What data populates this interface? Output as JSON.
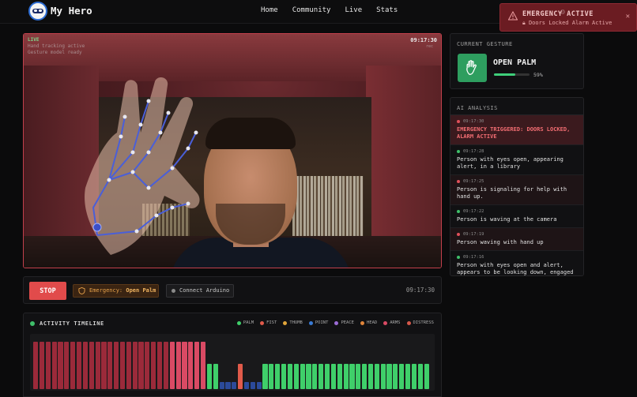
{
  "header": {
    "brand": "My Hero",
    "nav": [
      "Home",
      "Community",
      "Live",
      "Stats"
    ]
  },
  "toast": {
    "title": "EMERGENCY ACTIVE",
    "subtitle": "Doors Locked  Alarm Active",
    "close": "✕",
    "color": "#6b1c22"
  },
  "camera": {
    "live": "LIVE",
    "live_sub1": "Hand tracking active",
    "live_sub2": "Gesture model ready",
    "time": "09:17:30",
    "time_sub": "rec"
  },
  "controls": {
    "stop": "STOP",
    "emergency_prefix": "Emergency:",
    "emergency_value": "Open Palm",
    "arduino": "Connect Arduino",
    "time": "09:17:30"
  },
  "timeline": {
    "title": "ACTIVITY TIMELINE",
    "legend": [
      {
        "label": "PALM",
        "color": "#3fcf6a"
      },
      {
        "label": "FIST",
        "color": "#e05a4a"
      },
      {
        "label": "THUMB",
        "color": "#e0a43a"
      },
      {
        "label": "POINT",
        "color": "#3a7bd5"
      },
      {
        "label": "PEACE",
        "color": "#9b6cd6"
      },
      {
        "label": "HEAD",
        "color": "#e0853a"
      },
      {
        "label": "ARMS",
        "color": "#d94a64"
      },
      {
        "label": "DISTRESS",
        "color": "#d6584a"
      }
    ]
  },
  "chart_data": {
    "type": "bar",
    "title": "ACTIVITY TIMELINE",
    "ylim": [
      0,
      1
    ],
    "series": [
      {
        "name": "DISTRESS",
        "color": "#9b2a3a"
      },
      {
        "name": "ARMS",
        "color": "#d94a64"
      },
      {
        "name": "PALM",
        "color": "#3fcf6a"
      },
      {
        "name": "FIST",
        "color": "#e05a4a"
      },
      {
        "name": "POINT",
        "color": "#2b4a9a"
      }
    ],
    "bars": [
      {
        "s": "DISTRESS",
        "v": 0.96
      },
      {
        "s": "DISTRESS",
        "v": 0.96
      },
      {
        "s": "DISTRESS",
        "v": 0.96
      },
      {
        "s": "DISTRESS",
        "v": 0.96
      },
      {
        "s": "DISTRESS",
        "v": 0.96
      },
      {
        "s": "DISTRESS",
        "v": 0.96
      },
      {
        "s": "DISTRESS",
        "v": 0.96
      },
      {
        "s": "DISTRESS",
        "v": 0.96
      },
      {
        "s": "DISTRESS",
        "v": 0.96
      },
      {
        "s": "DISTRESS",
        "v": 0.96
      },
      {
        "s": "DISTRESS",
        "v": 0.96
      },
      {
        "s": "DISTRESS",
        "v": 0.96
      },
      {
        "s": "DISTRESS",
        "v": 0.96
      },
      {
        "s": "DISTRESS",
        "v": 0.96
      },
      {
        "s": "DISTRESS",
        "v": 0.96
      },
      {
        "s": "DISTRESS",
        "v": 0.96
      },
      {
        "s": "DISTRESS",
        "v": 0.96
      },
      {
        "s": "DISTRESS",
        "v": 0.96
      },
      {
        "s": "DISTRESS",
        "v": 0.96
      },
      {
        "s": "DISTRESS",
        "v": 0.96
      },
      {
        "s": "DISTRESS",
        "v": 0.96
      },
      {
        "s": "DISTRESS",
        "v": 0.96
      },
      {
        "s": "ARMS",
        "v": 0.96
      },
      {
        "s": "ARMS",
        "v": 0.96
      },
      {
        "s": "ARMS",
        "v": 0.96
      },
      {
        "s": "ARMS",
        "v": 0.96
      },
      {
        "s": "ARMS",
        "v": 0.96
      },
      {
        "s": "ARMS",
        "v": 0.96
      },
      {
        "s": "PALM",
        "v": 0.52
      },
      {
        "s": "PALM",
        "v": 0.52
      },
      {
        "s": "POINT",
        "v": 0.14
      },
      {
        "s": "POINT",
        "v": 0.14
      },
      {
        "s": "POINT",
        "v": 0.14
      },
      {
        "s": "FIST",
        "v": 0.52
      },
      {
        "s": "POINT",
        "v": 0.14
      },
      {
        "s": "POINT",
        "v": 0.14
      },
      {
        "s": "POINT",
        "v": 0.14
      },
      {
        "s": "PALM",
        "v": 0.52
      },
      {
        "s": "PALM",
        "v": 0.52
      },
      {
        "s": "PALM",
        "v": 0.52
      },
      {
        "s": "PALM",
        "v": 0.52
      },
      {
        "s": "PALM",
        "v": 0.52
      },
      {
        "s": "PALM",
        "v": 0.52
      },
      {
        "s": "PALM",
        "v": 0.52
      },
      {
        "s": "PALM",
        "v": 0.52
      },
      {
        "s": "PALM",
        "v": 0.52
      },
      {
        "s": "PALM",
        "v": 0.52
      },
      {
        "s": "PALM",
        "v": 0.52
      },
      {
        "s": "PALM",
        "v": 0.52
      },
      {
        "s": "PALM",
        "v": 0.52
      },
      {
        "s": "PALM",
        "v": 0.52
      },
      {
        "s": "PALM",
        "v": 0.52
      },
      {
        "s": "PALM",
        "v": 0.52
      },
      {
        "s": "PALM",
        "v": 0.52
      },
      {
        "s": "PALM",
        "v": 0.52
      },
      {
        "s": "PALM",
        "v": 0.52
      },
      {
        "s": "PALM",
        "v": 0.52
      },
      {
        "s": "PALM",
        "v": 0.52
      },
      {
        "s": "PALM",
        "v": 0.52
      },
      {
        "s": "PALM",
        "v": 0.52
      },
      {
        "s": "PALM",
        "v": 0.52
      },
      {
        "s": "PALM",
        "v": 0.52
      },
      {
        "s": "PALM",
        "v": 0.52
      },
      {
        "s": "PALM",
        "v": 0.52
      }
    ]
  },
  "gesture": {
    "title": "CURRENT GESTURE",
    "name": "OPEN PALM",
    "confidence": 0.59,
    "confidence_text": "59%",
    "icon": "hand-icon",
    "tile_color": "#2e9e5f"
  },
  "ai": {
    "title": "AI ANALYSIS",
    "entries": [
      {
        "time": "09:17:30",
        "text": "EMERGENCY TRIGGERED: DOORS LOCKED, ALARM ACTIVE",
        "kind": "alert"
      },
      {
        "time": "09:17:28",
        "text": "Person with eyes open, appearing alert, in a library",
        "kind": "green"
      },
      {
        "time": "09:17:25",
        "text": "Person is signaling for help with hand up.",
        "kind": "red"
      },
      {
        "time": "09:17:22",
        "text": "Person is waving at the camera",
        "kind": "green"
      },
      {
        "time": "09:17:19",
        "text": "Person waving with hand up",
        "kind": "red"
      },
      {
        "time": "09:17:16",
        "text": "Person with eyes open and alert, appears to be looking down, engaged",
        "kind": "green"
      }
    ]
  }
}
